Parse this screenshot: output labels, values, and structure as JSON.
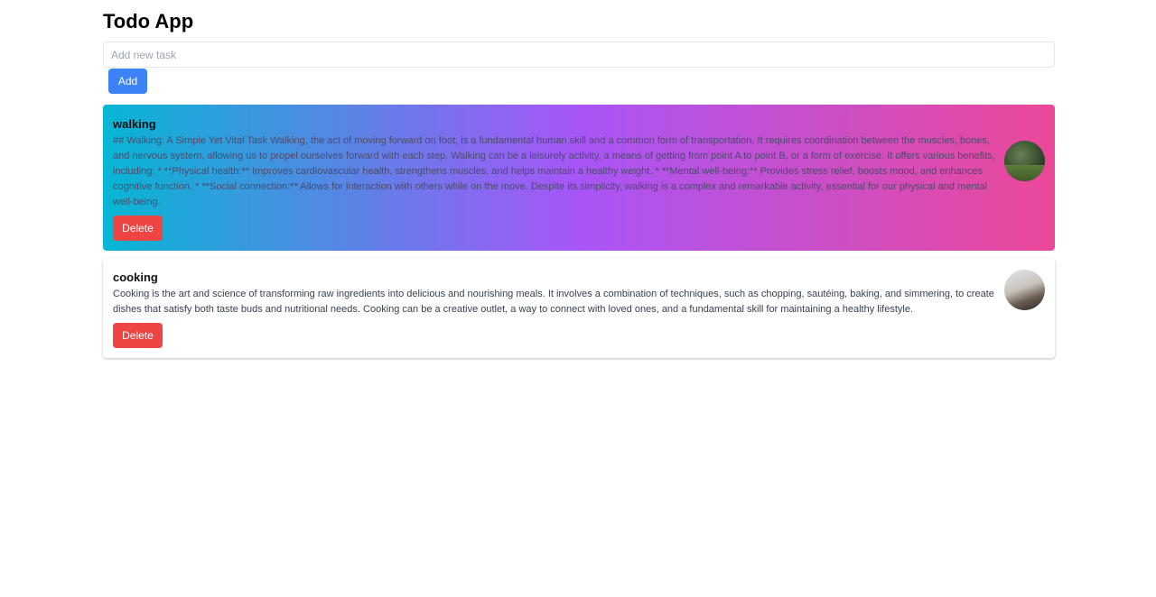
{
  "app": {
    "title": "Todo App"
  },
  "new_task": {
    "placeholder": "Add new task",
    "value": "",
    "add_label": "Add"
  },
  "tasks": [
    {
      "name": "walking",
      "description": "## Walking: A Simple Yet Vital Task Walking, the act of moving forward on foot, is a fundamental human skill and a common form of transportation. It requires coordination between the muscles, bones, and nervous system, allowing us to propel ourselves forward with each step. Walking can be a leisurely activity, a means of getting from point A to point B, or a form of exercise. It offers various benefits, including: * **Physical health:** Improves cardiovascular health, strengthens muscles, and helps maintain a healthy weight. * **Mental well-being:** Provides stress relief, boosts mood, and enhances cognitive function. * **Social connection:** Allows for interaction with others while on the move. Despite its simplicity, walking is a complex and remarkable activity, essential for our physical and mental well-being.",
      "delete_label": "Delete",
      "highlighted": true
    },
    {
      "name": "cooking",
      "description": "Cooking is the art and science of transforming raw ingredients into delicious and nourishing meals. It involves a combination of techniques, such as chopping, sautéing, baking, and simmering, to create dishes that satisfy both taste buds and nutritional needs. Cooking can be a creative outlet, a way to connect with loved ones, and a fundamental skill for maintaining a healthy lifestyle.",
      "delete_label": "Delete",
      "highlighted": false
    }
  ],
  "colors": {
    "add_button": "#3b82f6",
    "delete_button": "#ef4444",
    "gradient": [
      "#06b6d4",
      "#a855f7",
      "#ec4899"
    ]
  }
}
